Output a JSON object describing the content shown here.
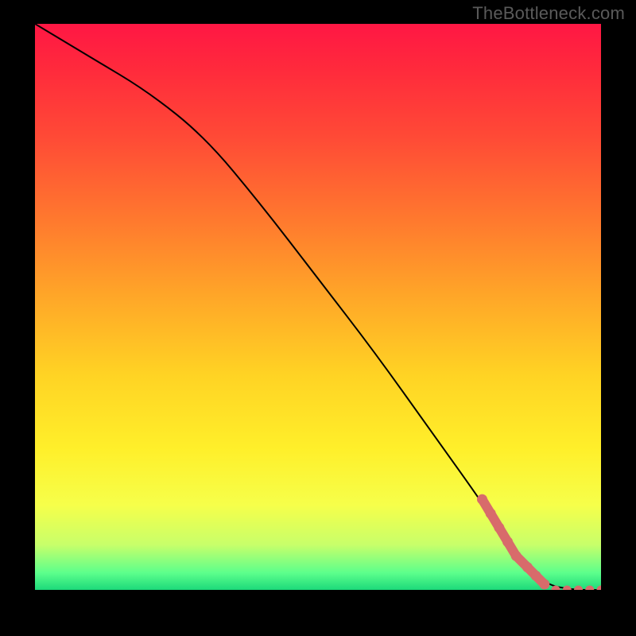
{
  "watermark": "TheBottleneck.com",
  "chart_data": {
    "type": "line",
    "title": "",
    "xlabel": "",
    "ylabel": "",
    "xlim": [
      0,
      100
    ],
    "ylim": [
      0,
      100
    ],
    "grid": false,
    "legend": false,
    "series": [
      {
        "name": "bottleneck-curve",
        "x": [
          0,
          10,
          20,
          30,
          40,
          50,
          60,
          70,
          80,
          85,
          90,
          95,
          100
        ],
        "y": [
          100,
          94,
          88,
          80,
          68,
          55,
          42,
          28,
          14,
          6,
          1,
          0,
          0
        ]
      }
    ],
    "highlight_points": {
      "name": "highlight-dots",
      "x": [
        79,
        80.5,
        82,
        83.5,
        85,
        87,
        88.5,
        90,
        92,
        94,
        96,
        98,
        100
      ],
      "y": [
        16,
        13.5,
        11,
        8.5,
        6,
        4,
        2.5,
        1,
        0,
        0,
        0,
        0,
        0
      ]
    }
  }
}
